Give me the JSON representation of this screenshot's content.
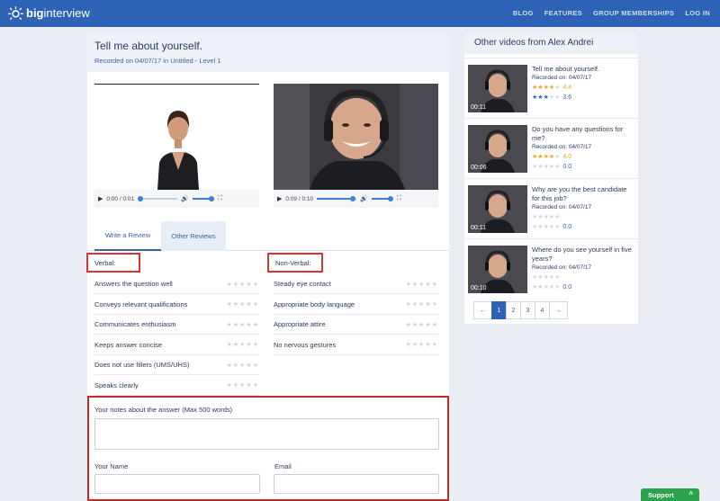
{
  "brand": {
    "logo_bold": "big",
    "logo_light": "interview"
  },
  "nav": {
    "items": [
      "BLOG",
      "FEATURES",
      "GROUP MEMBERSHIPS",
      "LOG IN"
    ]
  },
  "interview": {
    "title": "Tell me about yourself.",
    "recorded": "Recorded on 04/07/17 in Untitled - Level 1"
  },
  "videos": {
    "left": {
      "time": "0:00 / 0:01",
      "progress": 0.0,
      "volume": 0.85
    },
    "right": {
      "time": "0:09 / 0:10",
      "progress": 0.9,
      "volume": 0.85
    }
  },
  "tabs": {
    "write": "Write a Review",
    "other": "Other Reviews"
  },
  "verbal": {
    "header": "Verbal:",
    "items": [
      "Answers the question well",
      "Conveys relevant qualifications",
      "Communicates enthusiasm",
      "Keeps answer concise",
      "Does not use fillers (UMS/UHS)",
      "Speaks clearly"
    ]
  },
  "nonverbal": {
    "header": "Non-Verbal:",
    "items": [
      "Steady eye contact",
      "Appropriate body language",
      "Appropriate attire",
      "No nervous gestures"
    ]
  },
  "form": {
    "notes_label": "Your notes about the answer (Max 500 words)",
    "name_label": "Your Name",
    "email_label": "Email"
  },
  "sidebar": {
    "title": "Other videos from Alex Andrei",
    "items": [
      {
        "title": "Tell me about yourself.",
        "recorded": "Recorded on: 04/07/17",
        "duration": "00:11",
        "rating1": "4.4",
        "rating2": "3.6",
        "stars1": 4,
        "stars2": 3
      },
      {
        "title": "Do you have any questions for me?",
        "recorded": "Recorded on: 04/07/17",
        "duration": "00:06",
        "rating1": "4.0",
        "rating2": "0.0",
        "stars1": 4,
        "stars2": 0
      },
      {
        "title": "Why are you the best candidate for this job?",
        "recorded": "Recorded on: 04/07/17",
        "duration": "00:11",
        "rating1": "",
        "rating2": "0.0",
        "stars1": 0,
        "stars2": 0
      },
      {
        "title": "Where do you see yourself in five years?",
        "recorded": "Recorded on: 04/07/17",
        "duration": "00:10",
        "rating1": "",
        "rating2": "0.0",
        "stars1": 0,
        "stars2": 0
      }
    ],
    "pager": {
      "prev": "←",
      "pages": [
        "1",
        "2",
        "3",
        "4"
      ],
      "next": "→",
      "active": "1"
    }
  },
  "support": {
    "label": "Support",
    "chevron": "^"
  },
  "colors": {
    "brand_blue": "#2d62b4",
    "highlight_red": "#cc2a2a",
    "star_gold": "#f0a81c",
    "star_blue": "#3d62a8",
    "support_green": "#2ca34a"
  },
  "icons": [
    "sun-logo-icon",
    "play-icon",
    "volume-icon",
    "fullscreen-icon",
    "star-icon",
    "arrow-left-icon",
    "arrow-right-icon",
    "chevron-up-icon"
  ]
}
